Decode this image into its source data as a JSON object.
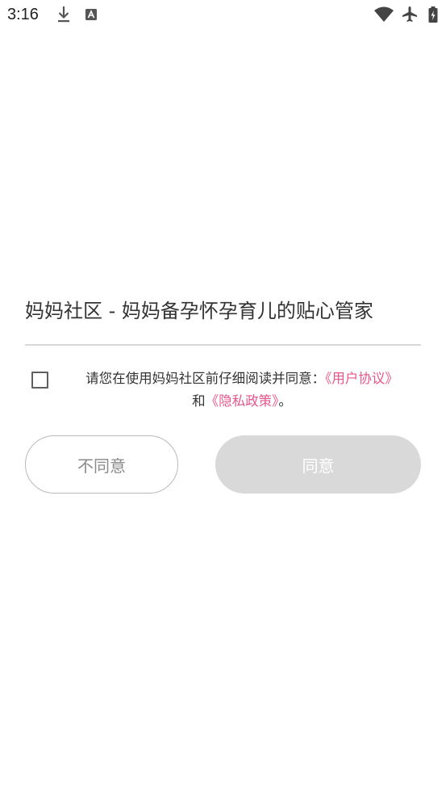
{
  "status_bar": {
    "time": "3:16",
    "icons": [
      "download-icon",
      "app-notification-icon",
      "wifi-icon",
      "airplane-mode-icon",
      "battery-charging-icon"
    ]
  },
  "dialog": {
    "title": "妈妈社区 - 妈妈备孕怀孕育儿的贴心管家",
    "agreement": {
      "prefix": "请您在使用妈妈社区前仔细阅读并同意：",
      "user_agreement_link": "《用户协议》",
      "conjunction": "和",
      "privacy_policy_link": "《隐私政策》",
      "suffix": "。",
      "checked": false
    },
    "buttons": {
      "disagree_label": "不同意",
      "agree_label": "同意"
    }
  },
  "colors": {
    "link": "#e8578b",
    "agree_button_bg": "#d9d9d9",
    "disagree_border": "#b9b9b9"
  }
}
